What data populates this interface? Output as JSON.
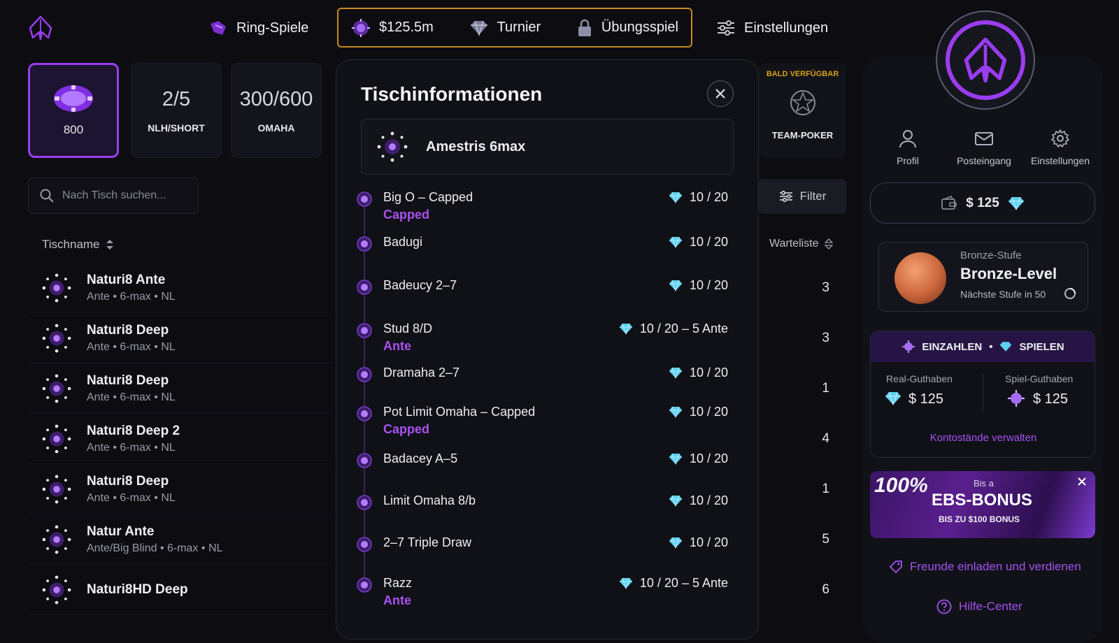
{
  "nav": {
    "ring_games": "Ring-Spiele",
    "balance": "$125.5m",
    "tournament": "Turnier",
    "practice": "Übungsspiel",
    "settings": "Einstellungen"
  },
  "stakes": [
    {
      "big": "",
      "small": "800",
      "active": true
    },
    {
      "big": "2/5",
      "small": "NLH/SHORT",
      "active": false
    },
    {
      "big": "300/600",
      "small": "OMAHA",
      "active": false
    }
  ],
  "search": {
    "placeholder": "Nach Tisch suchen..."
  },
  "columns": {
    "table_name": "Tischname",
    "waitlist": "Warteliste"
  },
  "tables": [
    {
      "name": "Naturi8 Ante",
      "sub": "Ante • 6-max • NL",
      "wait": "3"
    },
    {
      "name": "Naturi8 Deep",
      "sub": "Ante • 6-max • NL",
      "wait": "3"
    },
    {
      "name": "Naturi8 Deep",
      "sub": "Ante • 6-max • NL",
      "wait": "1"
    },
    {
      "name": "Naturi8 Deep 2",
      "sub": "Ante • 6-max • NL",
      "wait": "4"
    },
    {
      "name": "Naturi8 Deep",
      "sub": "Ante • 6-max • NL",
      "wait": "1"
    },
    {
      "name": "Natur Ante",
      "sub": "Ante/Big Blind • 6-max • NL",
      "wait": "5"
    },
    {
      "name": "Naturi8HD Deep",
      "sub": "",
      "wait": "6"
    }
  ],
  "modal": {
    "title": "Tischinformationen",
    "table_name": "Amestris 6max",
    "games": [
      {
        "name": "Big O – Capped",
        "tag": "Capped",
        "stakes": "10 / 20"
      },
      {
        "name": "Badugi",
        "tag": "",
        "stakes": "10 / 20"
      },
      {
        "name": "Badeucy 2–7",
        "tag": "",
        "stakes": "10 / 20"
      },
      {
        "name": "Stud 8/D",
        "tag": "Ante",
        "stakes": "10 / 20 – 5 Ante"
      },
      {
        "name": "Dramaha 2–7",
        "tag": "",
        "stakes": "10 / 20"
      },
      {
        "name": "Pot Limit Omaha – Capped",
        "tag": "Capped",
        "stakes": "10 / 20"
      },
      {
        "name": "Badacey A–5",
        "tag": "",
        "stakes": "10 / 20"
      },
      {
        "name": "Limit Omaha 8/b",
        "tag": "",
        "stakes": "10 / 20"
      },
      {
        "name": "2–7 Triple Draw",
        "tag": "",
        "stakes": "10 / 20"
      },
      {
        "name": "Razz",
        "tag": "Ante",
        "stakes": "10 / 20 – 5 Ante"
      }
    ]
  },
  "team_poker": {
    "tag": "BALD VERFÜGBAR",
    "label": "TEAM-POKER"
  },
  "filter": "Filter",
  "account": {
    "profile": "Profil",
    "inbox": "Posteingang",
    "settings": "Einstellungen",
    "balance": "$ 125",
    "level_tier": "Bronze-Stufe",
    "level_name": "Bronze-Level",
    "next_level": "Nächste Stufe in 50",
    "deposit": "EINZAHLEN",
    "separator": "•",
    "play": "SPIELEN",
    "real_label": "Real-Guthaben",
    "real_value": "$ 125",
    "play_label": "Spiel-Guthaben",
    "play_value": "$ 125",
    "manage": "Kontostände verwalten"
  },
  "promo": {
    "percent": "100%",
    "top": "Bis a",
    "title": "EBS-BONUS",
    "sub": "BIS ZU $100 BONUS"
  },
  "links": {
    "invite": "Freunde einladen und verdienen",
    "help": "Hilfe-Center"
  },
  "colors": {
    "accent": "#9a3cf0",
    "gold_border": "#c68a1d",
    "tag_purple": "#a952f0",
    "soon_gold": "#d7a21a",
    "background": "#0c0c11"
  }
}
